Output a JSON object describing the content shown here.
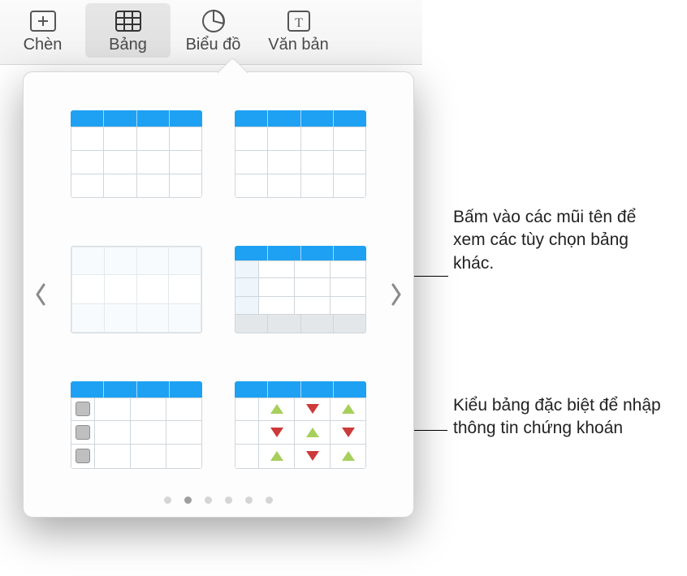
{
  "toolbar": {
    "items": [
      {
        "label": "Chèn",
        "icon": "insert-icon"
      },
      {
        "label": "Bảng",
        "icon": "table-icon"
      },
      {
        "label": "Biểu đồ",
        "icon": "chart-icon"
      },
      {
        "label": "Văn bản",
        "icon": "text-icon"
      }
    ],
    "selected_index": 1
  },
  "table_popover": {
    "styles": [
      {
        "name": "table-style-basic-lines"
      },
      {
        "name": "table-style-header-only"
      },
      {
        "name": "table-style-plain-no-header"
      },
      {
        "name": "table-style-row-header-footer"
      },
      {
        "name": "table-style-checkboxes"
      },
      {
        "name": "table-style-stocks"
      }
    ],
    "page_count": 6,
    "active_page_index": 1
  },
  "callouts": {
    "arrows": "Bấm vào các mũi tên để xem các tùy chọn bảng khác.",
    "stocks": "Kiểu bảng đặc biệt để nhập thông tin chứng khoán"
  },
  "colors": {
    "accent": "#1ea1f2",
    "triangle_up": "#a6cf5c",
    "triangle_down": "#cc3a3a"
  }
}
